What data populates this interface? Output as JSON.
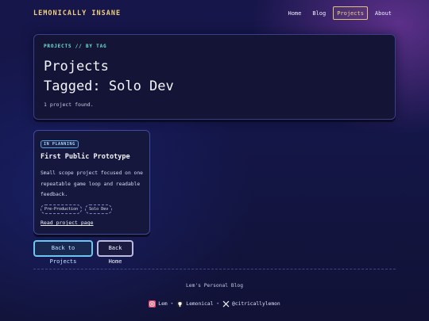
{
  "header": {
    "brand": "LEMONICALLY INSANE",
    "nav": [
      "Home",
      "Blog",
      "Projects",
      "About"
    ],
    "active_nav": "Projects"
  },
  "hero": {
    "eyebrow": "PROJECTS // BY TAG",
    "title_line1": "Projects",
    "title_line2": "Tagged: Solo Dev",
    "count_text": "1 project found."
  },
  "projects": [
    {
      "status": "IN PLANNING",
      "title": "First Public Prototype",
      "description": "Small scope project focused on one repeatable game loop and readable feedback.",
      "tags": [
        "Pre-Production",
        "Solo Dev"
      ],
      "link_label": "Read project page"
    }
  ],
  "actions": {
    "back_to_projects": "Back to Projects",
    "back_home": "Back Home"
  },
  "footer": {
    "title": "Lem's Personal Blog",
    "social": [
      {
        "label": "Lem",
        "icon": "instagram-icon"
      },
      {
        "label": "Lemonical",
        "icon": "github-icon"
      },
      {
        "label": "@citricallylemon",
        "icon": "x-icon"
      }
    ],
    "separator": "•"
  },
  "colors": {
    "brand": "#f0cf7a",
    "eyebrow": "#6fe3d2",
    "active_nav_border": "#e7c07f",
    "card_border": "#3f4a9a",
    "primary_button_border": "#6cc6ee"
  }
}
